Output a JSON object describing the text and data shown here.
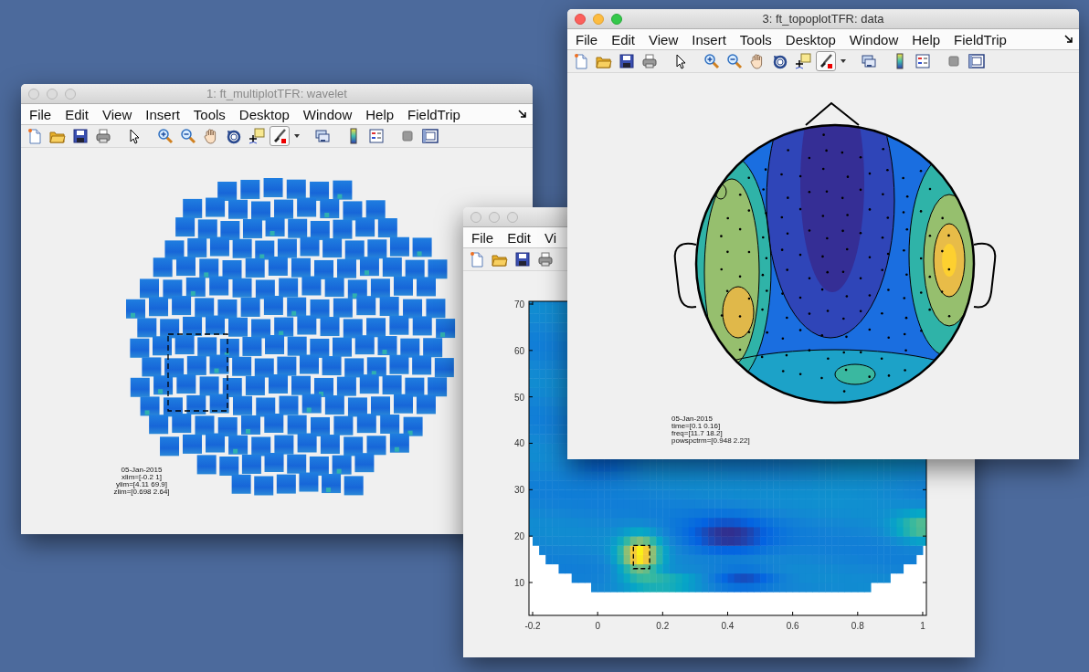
{
  "windows": [
    {
      "title": "1: ft_multiplotTFR: wavelet",
      "active": false,
      "menu": [
        "File",
        "Edit",
        "View",
        "Insert",
        "Tools",
        "Desktop",
        "Window",
        "Help",
        "FieldTrip"
      ],
      "toolbar": [
        {
          "kind": "new",
          "pressed": false
        },
        {
          "kind": "open",
          "pressed": false
        },
        {
          "kind": "save",
          "pressed": false
        },
        {
          "kind": "print",
          "pressed": false
        },
        {
          "kind": "pointer",
          "pressed": false
        },
        {
          "kind": "zoomin",
          "pressed": false
        },
        {
          "kind": "zoomout",
          "pressed": false
        },
        {
          "kind": "pan",
          "pressed": false
        },
        {
          "kind": "rotate",
          "pressed": false
        },
        {
          "kind": "cursor",
          "pressed": false
        },
        {
          "kind": "brush",
          "pressed": true
        },
        {
          "kind": "caret",
          "pressed": false
        },
        {
          "kind": "link",
          "pressed": false
        },
        {
          "kind": "colorbar",
          "pressed": false
        },
        {
          "kind": "legend",
          "pressed": false
        },
        {
          "kind": "hide",
          "pressed": false
        },
        {
          "kind": "show",
          "pressed": false
        }
      ],
      "plot": {
        "kind": "multiplot",
        "annotation": [
          "05-Jan-2015",
          "xlim=[-0.2 1]",
          "ylim=[4.11 69.9]",
          "zlim=[0.698 2.64]"
        ]
      }
    },
    {
      "active": false,
      "menu": [
        "File",
        "Edit",
        "Vi"
      ],
      "toolbar": [
        {
          "kind": "new",
          "pressed": false
        },
        {
          "kind": "open",
          "pressed": false
        },
        {
          "kind": "save",
          "pressed": false
        },
        {
          "kind": "print",
          "pressed": false
        }
      ],
      "plot": {
        "kind": "tfr",
        "y_ticks": [
          "70",
          "60",
          "50",
          "40",
          "30",
          "20",
          "10"
        ],
        "x_ticks": [
          "-0.2",
          "0",
          "0.2",
          "0.4",
          "0.6",
          "0.8",
          "1"
        ]
      }
    },
    {
      "title": "3: ft_topoplotTFR: data",
      "active": true,
      "menu": [
        "File",
        "Edit",
        "View",
        "Insert",
        "Tools",
        "Desktop",
        "Window",
        "Help",
        "FieldTrip"
      ],
      "toolbar": [
        {
          "kind": "new",
          "pressed": false
        },
        {
          "kind": "open",
          "pressed": false
        },
        {
          "kind": "save",
          "pressed": false
        },
        {
          "kind": "print",
          "pressed": false
        },
        {
          "kind": "pointer",
          "pressed": false
        },
        {
          "kind": "zoomin",
          "pressed": false
        },
        {
          "kind": "zoomout",
          "pressed": false
        },
        {
          "kind": "pan",
          "pressed": false
        },
        {
          "kind": "rotate",
          "pressed": false
        },
        {
          "kind": "cursor",
          "pressed": false
        },
        {
          "kind": "brush",
          "pressed": true
        },
        {
          "kind": "caret",
          "pressed": false
        },
        {
          "kind": "link",
          "pressed": false
        },
        {
          "kind": "colorbar",
          "pressed": false
        },
        {
          "kind": "legend",
          "pressed": false
        },
        {
          "kind": "hide",
          "pressed": false
        },
        {
          "kind": "show",
          "pressed": false
        }
      ],
      "plot": {
        "kind": "topo",
        "annotation": [
          "05-Jan-2015",
          "time=[0.1 0.16]",
          "freq=[11.7 18.2]",
          "powspctrm=[0.948 2.22]"
        ]
      }
    }
  ]
}
